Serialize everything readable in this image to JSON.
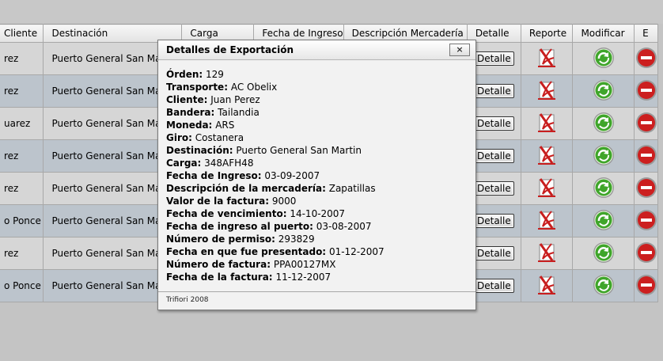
{
  "table": {
    "headers": [
      "Cliente",
      "Destinación",
      "Carga",
      "Fecha de Ingreso",
      "Descripción Mercadería",
      "Detalle",
      "Reporte",
      "Modificar",
      "E"
    ],
    "rows": [
      {
        "cliente": "rez",
        "destino": "Puerto General San Martin",
        "detalle": "Detalle"
      },
      {
        "cliente": "rez",
        "destino": "Puerto General San Martin",
        "detalle": "Detalle"
      },
      {
        "cliente": "uarez",
        "destino": "Puerto General San Martin",
        "detalle": "Detalle"
      },
      {
        "cliente": "rez",
        "destino": "Puerto General San Martin",
        "detalle": "Detalle"
      },
      {
        "cliente": "rez",
        "destino": "Puerto General San Martin",
        "detalle": "Detalle"
      },
      {
        "cliente": "o Ponce",
        "destino": "Puerto General San Martin",
        "detalle": "Detalle"
      },
      {
        "cliente": "rez",
        "destino": "Puerto General San Martin",
        "detalle": "Detalle"
      },
      {
        "cliente": "o Ponce",
        "destino": "Puerto General San Martin",
        "detalle": "Detalle"
      }
    ]
  },
  "modal": {
    "title": "Detalles de Exportación",
    "close": "×",
    "fields": [
      {
        "label": "Órden:",
        "value": "129"
      },
      {
        "label": "Transporte:",
        "value": "AC Obelix"
      },
      {
        "label": "Cliente:",
        "value": "Juan Perez"
      },
      {
        "label": "Bandera:",
        "value": "Tailandia"
      },
      {
        "label": "Moneda:",
        "value": "ARS"
      },
      {
        "label": "Giro:",
        "value": "Costanera"
      },
      {
        "label": "Destinación:",
        "value": "Puerto General San Martin"
      },
      {
        "label": "Carga:",
        "value": "348AFH48"
      },
      {
        "label": "Fecha de Ingreso:",
        "value": "03-09-2007"
      },
      {
        "label": "Descripción de la mercadería:",
        "value": "Zapatillas"
      },
      {
        "label": "Valor de la factura:",
        "value": "9000"
      },
      {
        "label": "Fecha de vencimiento:",
        "value": "14-10-2007"
      },
      {
        "label": "Fecha de ingreso al puerto:",
        "value": "03-08-2007"
      },
      {
        "label": "Número de permiso:",
        "value": "293829"
      },
      {
        "label": "Fecha en que fue presentado:",
        "value": "01-12-2007"
      },
      {
        "label": "Número de factura:",
        "value": "PPA00127MX"
      },
      {
        "label": "Fecha de la factura:",
        "value": "11-12-2007"
      }
    ],
    "footer": "Trifiori 2008"
  },
  "icons": {
    "report": "pdf-report-icon",
    "modify": "green-refresh-icon",
    "delete": "red-delete-icon"
  },
  "colors": {
    "row_odd": "#d6d6d6",
    "row_even": "#bcc4cc",
    "modify_green": "#3fa52a",
    "delete_red": "#cc1f1f",
    "report_red": "#c81e1e"
  }
}
